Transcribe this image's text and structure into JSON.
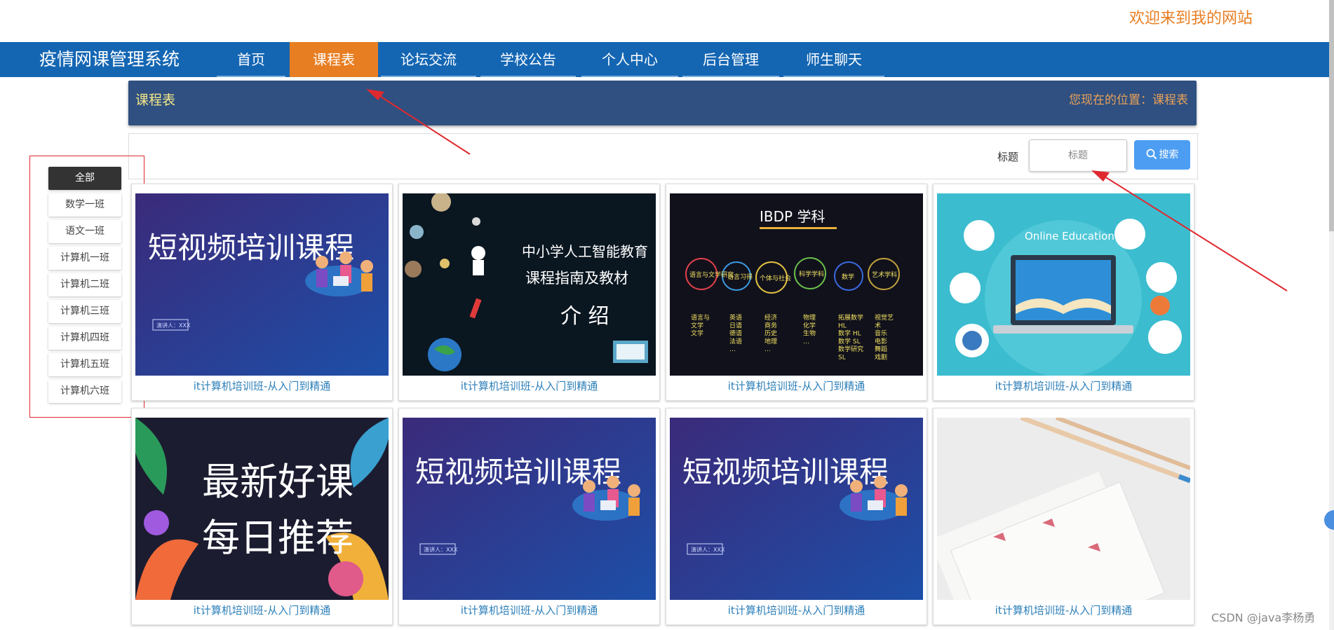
{
  "welcome_text": "欢迎来到我的网站",
  "nav": {
    "brand": "疫情网课管理系统",
    "items": [
      {
        "label": "首页"
      },
      {
        "label": "课程表"
      },
      {
        "label": "论坛交流"
      },
      {
        "label": "学校公告"
      },
      {
        "label": "个人中心"
      },
      {
        "label": "后台管理"
      },
      {
        "label": "师生聊天"
      }
    ],
    "active_index": 1,
    "bg_color": "#1466b3",
    "active_color": "#e87e22"
  },
  "page_header": {
    "title": "课程表",
    "location": "您现在的位置：课程表"
  },
  "search": {
    "label": "标题",
    "placeholder": "标题",
    "value": "",
    "button_label": "搜索"
  },
  "categories": {
    "items": [
      "全部",
      "数学一班",
      "语文一班",
      "计算机一班",
      "计算机二班",
      "计算机三班",
      "计算机四班",
      "计算机五班",
      "计算机六班"
    ],
    "active_index": 0
  },
  "courses": [
    {
      "title": "it计算机培训班-从入门到精通",
      "thumb": {
        "headline": "短视频培训课程",
        "presenter": "演讲人：XXX"
      }
    },
    {
      "title": "it计算机培训班-从入门到精通",
      "thumb": {
        "line1": "中小学人工智能教育",
        "line2": "课程指南及教材",
        "line3": "介 绍"
      }
    },
    {
      "title": "it计算机培训班-从入门到精通",
      "thumb": {
        "heading": "IBDP 学科",
        "circles": [
          "语言与文学研究",
          "语言习得",
          "个体与社会",
          "科学学科",
          "数学",
          "艺术学科"
        ],
        "columns": [
          "语言与\n文学\n文学",
          "英语\n日语\n德语\n法语\n…",
          "经济\n商务\n历史\n地理\n…",
          "物理\n化学\n生物\n…",
          "拓展数学\nHL\n数学 HL\n数学 SL\n数学研究\nSL",
          "视觉艺\n术\n音乐\n电影\n舞蹈\n戏剧"
        ]
      }
    },
    {
      "title": "it计算机培训班-从入门到精通",
      "thumb": {
        "caption": "Online Education"
      }
    },
    {
      "title": "it计算机培训班-从入门到精通",
      "thumb": {
        "line1": "最新好课",
        "line2": "每日推荐"
      }
    },
    {
      "title": "it计算机培训班-从入门到精通",
      "thumb": {
        "headline": "短视频培训课程",
        "presenter": "演讲人：XXX"
      }
    },
    {
      "title": "it计算机培训班-从入门到精通",
      "thumb": {
        "headline": "短视频培训课程",
        "presenter": "演讲人：XXX"
      }
    },
    {
      "title": "it计算机培训班-从入门到精通",
      "thumb": {}
    }
  ],
  "watermark": "CSDN @java李杨勇",
  "colors": {
    "header_bg": "#2f5080",
    "search_button": "#4d9ef2",
    "course_title": "#2c7fb8",
    "annotation_red": "#e0292f"
  }
}
